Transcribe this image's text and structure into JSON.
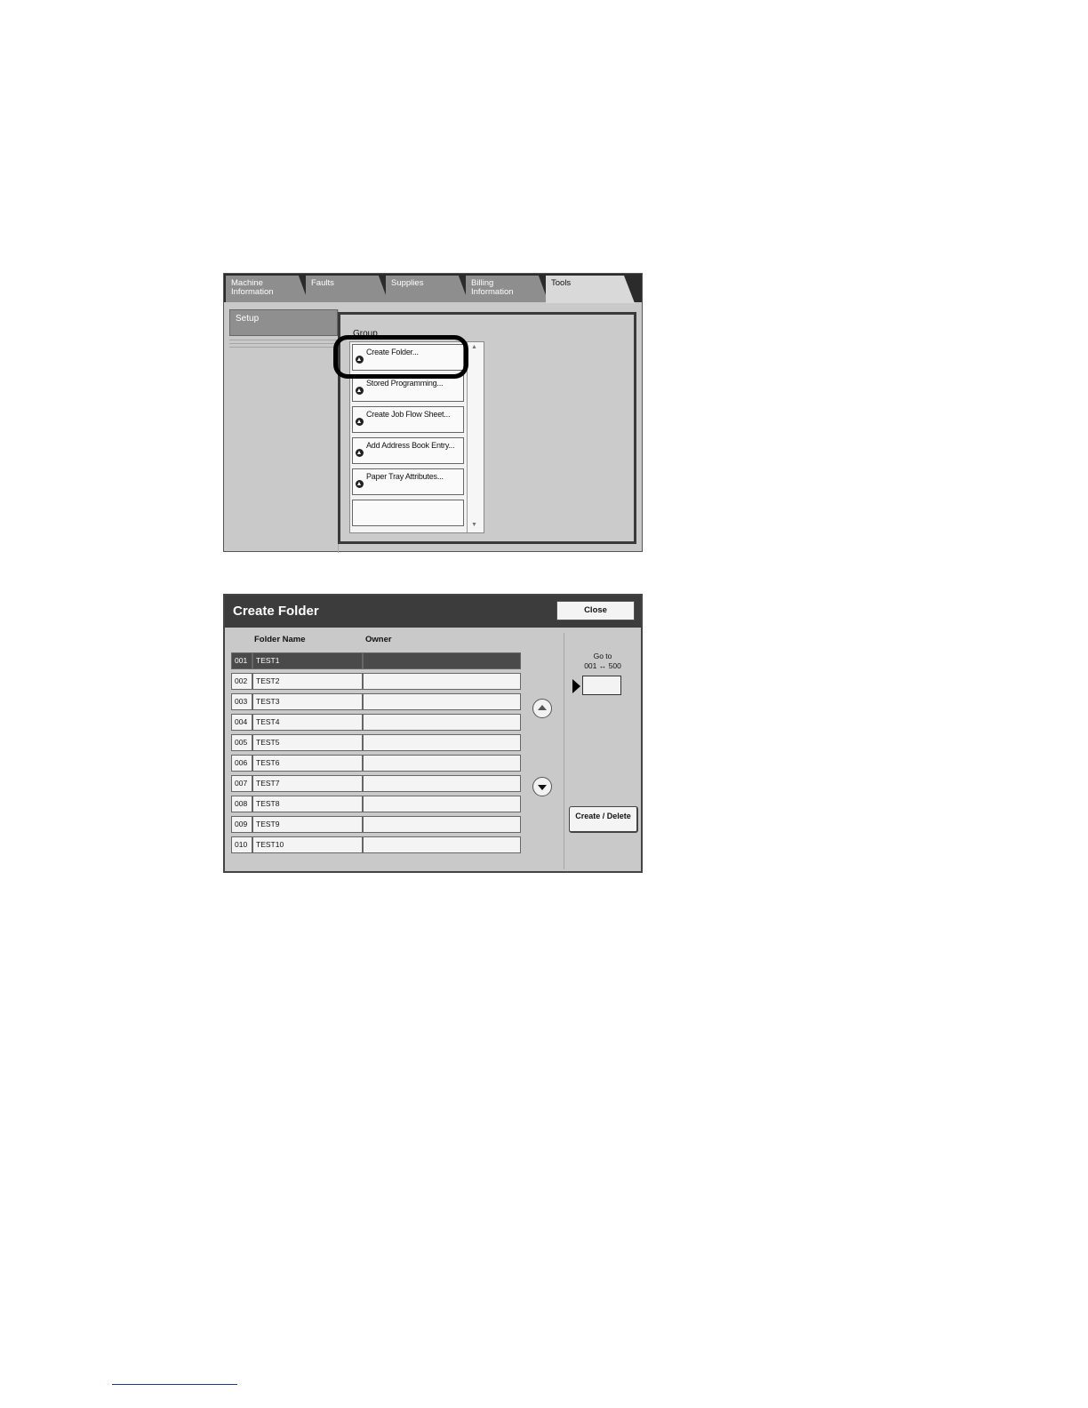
{
  "tools_screen": {
    "tabs": [
      {
        "label": "Machine\nInformation"
      },
      {
        "label": "Faults"
      },
      {
        "label": "Supplies"
      },
      {
        "label": "Billing\nInformation"
      },
      {
        "label": "Tools"
      }
    ],
    "active_tab": "Tools",
    "sidebar": {
      "selected": "Setup"
    },
    "group": {
      "label": "Group",
      "items": [
        {
          "label": "Create Folder..."
        },
        {
          "label": "Stored Programming..."
        },
        {
          "label": "Create Job Flow Sheet..."
        },
        {
          "label": "Add Address Book Entry..."
        },
        {
          "label": "Paper Tray Attributes..."
        },
        {
          "label": ""
        }
      ],
      "highlighted": "Create Folder..."
    }
  },
  "create_folder_screen": {
    "title": "Create Folder",
    "close_label": "Close",
    "columns": {
      "folder_name": "Folder Name",
      "owner": "Owner"
    },
    "rows": [
      {
        "num": "001",
        "name": "TEST1",
        "owner": ""
      },
      {
        "num": "002",
        "name": "TEST2",
        "owner": ""
      },
      {
        "num": "003",
        "name": "TEST3",
        "owner": ""
      },
      {
        "num": "004",
        "name": "TEST4",
        "owner": ""
      },
      {
        "num": "005",
        "name": "TEST5",
        "owner": ""
      },
      {
        "num": "006",
        "name": "TEST6",
        "owner": ""
      },
      {
        "num": "007",
        "name": "TEST7",
        "owner": ""
      },
      {
        "num": "008",
        "name": "TEST8",
        "owner": ""
      },
      {
        "num": "009",
        "name": "TEST9",
        "owner": ""
      },
      {
        "num": "010",
        "name": "TEST10",
        "owner": ""
      }
    ],
    "selected_row": "001",
    "goto": {
      "label": "Go to",
      "range": "001 ↔ 500",
      "value": ""
    },
    "create_delete_label": "Create / Delete"
  }
}
